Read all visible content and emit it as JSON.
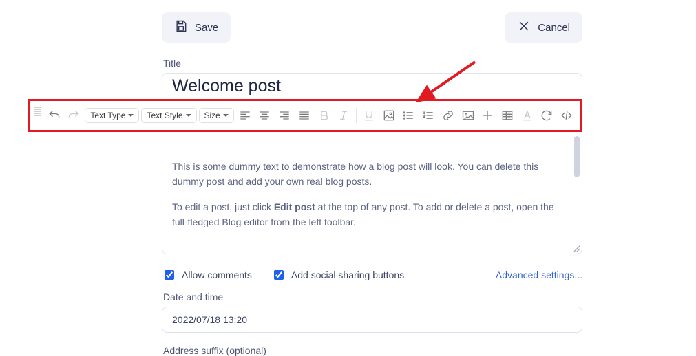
{
  "actions": {
    "save": "Save",
    "cancel": "Cancel"
  },
  "labels": {
    "title": "Title",
    "date_time": "Date and time",
    "address_suffix": "Address suffix (optional)",
    "allow_comments": "Allow comments",
    "add_social": "Add social sharing buttons",
    "advanced": "Advanced settings..."
  },
  "fields": {
    "title_value": "Welcome post",
    "datetime_value": "2022/07/18 13:20"
  },
  "toolbar": {
    "text_type": "Text Type",
    "text_style": "Text Style",
    "size": "Size"
  },
  "editor": {
    "p1": "This is some dummy text to demonstrate how a blog post will look. You can delete this dummy post and add your own real blog posts.",
    "p2_pre": "To edit a post, just click ",
    "p2_bold": "Edit post",
    "p2_post": " at the top of any post. To add or delete a post, open the full-fledged Blog editor from the left toolbar."
  },
  "icons": {
    "save": "save-icon",
    "cancel": "close-icon",
    "undo": "undo-icon",
    "redo": "redo-icon",
    "align_left": "align-left-icon",
    "align_center": "align-center-icon",
    "align_right": "align-right-icon",
    "align_justify": "align-justify-icon",
    "bold": "bold-icon",
    "italic": "italic-icon",
    "underline": "underline-icon",
    "image_square": "image-square-icon",
    "bullet_list": "bullet-list-icon",
    "numbered_list": "numbered-list-icon",
    "link": "link-icon",
    "image": "image-icon",
    "plus": "plus-icon",
    "table": "table-icon",
    "text_color": "text-color-icon",
    "reload": "reload-icon",
    "code": "code-icon"
  },
  "checkbox_state": {
    "allow_comments": true,
    "add_social": true
  }
}
